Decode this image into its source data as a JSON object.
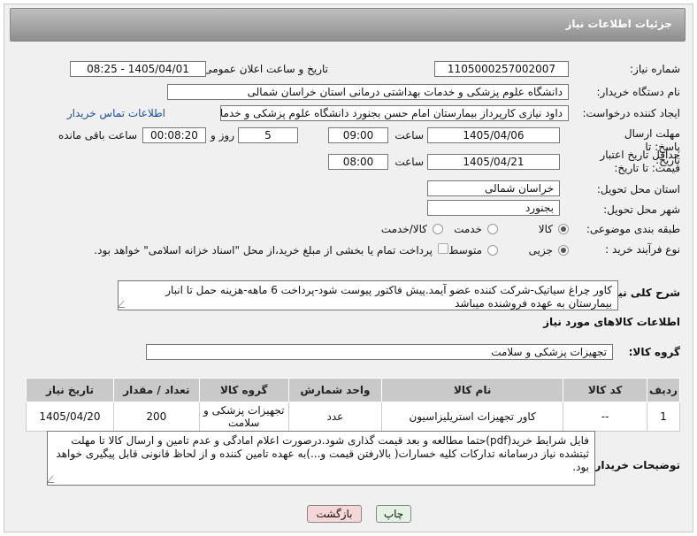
{
  "header": {
    "title": "جزئیات اطلاعات نیاز"
  },
  "need_number": {
    "label": "شماره نیاز:",
    "value": "1105000257002007"
  },
  "announce": {
    "label": "تاریخ و ساعت اعلان عمومی:",
    "value": "1405/04/01 - 08:25"
  },
  "buyer": {
    "label": "نام دستگاه خریدار:",
    "value": "دانشگاه علوم پزشکی و خدمات بهداشتی درمانی استان خراسان شمالی"
  },
  "creator": {
    "label": "ایجاد کننده درخواست:",
    "value": "داود نیازی کارپرداز بیمارستان امام حسن بجنورد دانشگاه علوم پزشکی و خدمات",
    "contact_link": "اطلاعات تماس خریدار"
  },
  "reply_deadline": {
    "label": "مهلت ارسال پاسخ: تا تاریخ:",
    "date": "1405/04/06",
    "time_label": "ساعت",
    "time": "09:00",
    "days": "5",
    "days_label": "روز و",
    "remaining": "00:08:20",
    "remaining_label": "ساعت باقی مانده"
  },
  "price_validity": {
    "label": "حداقل تاریخ اعتبار قیمت: تا تاریخ:",
    "date": "1405/04/21",
    "time_label": "ساعت",
    "time": "08:00"
  },
  "province": {
    "label": "استان محل تحویل:",
    "value": "خراسان شمالی"
  },
  "city": {
    "label": "شهر محل تحویل:",
    "value": "بجنورد"
  },
  "category": {
    "label": "طبقه بندی موضوعی:",
    "options": [
      "کالا",
      "خدمت",
      "کالا/خدمت"
    ],
    "selected": 0
  },
  "purchase_type": {
    "label": "نوع فرآیند خرید :",
    "options": [
      "جزیی",
      "متوسط"
    ],
    "selected": 0,
    "note": "پرداخت تمام یا بخشی از مبلغ خرید،از محل \"اسناد خزانه اسلامی\" خواهد بود."
  },
  "description": {
    "label": "شرح کلی نیاز:",
    "value": "کاور چراغ سیاتیک-شرکت کننده عضو آیمد.پیش فاکتور پیوست  شود-پرداخت 6 ماهه-هزینه حمل تا انبار بیمارستان به عهده فروشنده میباشد"
  },
  "goods_section": {
    "title": "اطلاعات کالاهای مورد نیاز"
  },
  "goods_group": {
    "label": "گروه کالا:",
    "value": "تجهیزات پزشکی و سلامت"
  },
  "table": {
    "headers": [
      "ردیف",
      "کد کالا",
      "نام کالا",
      "واحد شمارش",
      "گروه کالا",
      "تعداد / مقدار",
      "تاریخ نیاز"
    ],
    "rows": [
      [
        "1",
        "--",
        "کاور تجهیزات استریلیزاسیون",
        "عدد",
        "تجهیزات پزشکی و سلامت",
        "200",
        "1405/04/20"
      ]
    ]
  },
  "buyer_notes": {
    "label": "توضیحات خریدار:",
    "value": "فایل شرایط خرید(pdf)حتما مطالعه و بعد قیمت گذاری شود.درصورت اعلام امادگی و عدم تامین و ارسال کالا تا مهلت ثبتشده نیاز درسامانه تدارکات کلیه خسارات( بالارفتن قیمت و...)به عهده تامین کننده و از لحاظ قانونی قابل پیگیری خواهد بود."
  },
  "buttons": {
    "print": "چاپ",
    "back": "بازگشت"
  },
  "colors": {
    "header": "#9e9e9e",
    "link": "#1a4fa0",
    "back_button": "#f6d6d6",
    "print_button": "#e4f2e4"
  }
}
